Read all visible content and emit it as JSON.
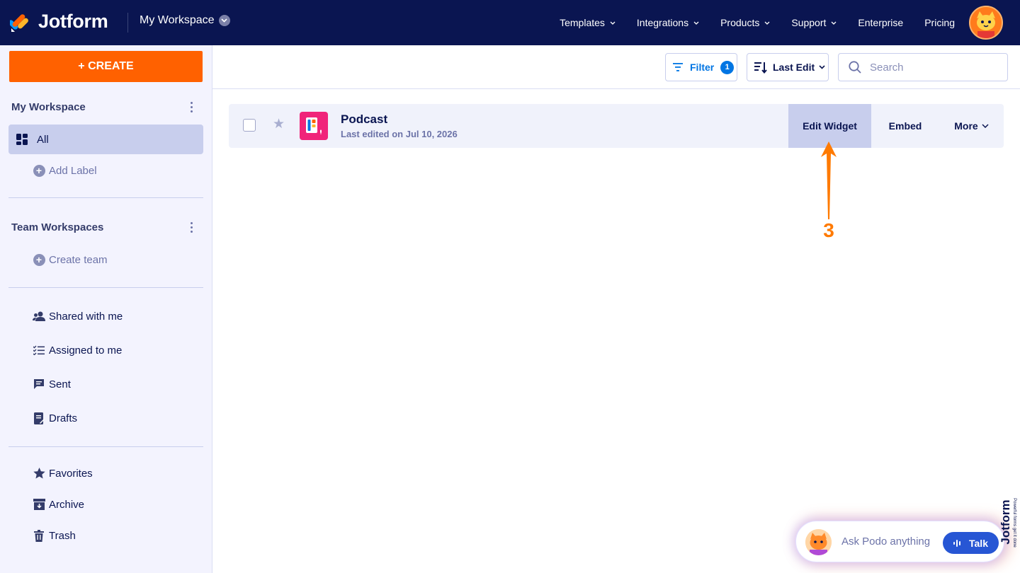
{
  "topbar": {
    "brand": "Jotform",
    "workspace": "My Workspace",
    "nav": [
      {
        "label": "Templates",
        "has_caret": true
      },
      {
        "label": "Integrations",
        "has_caret": true
      },
      {
        "label": "Products",
        "has_caret": true
      },
      {
        "label": "Support",
        "has_caret": true
      },
      {
        "label": "Enterprise",
        "has_caret": false
      },
      {
        "label": "Pricing",
        "has_caret": false
      }
    ]
  },
  "sidebar": {
    "create_label": "+ CREATE",
    "my_workspace": "My Workspace",
    "all_label": "All",
    "add_label": "Add Label",
    "team_workspaces": "Team Workspaces",
    "create_team": "Create team",
    "shared": "Shared with me",
    "assigned": "Assigned to me",
    "sent": "Sent",
    "drafts": "Drafts",
    "favorites": "Favorites",
    "archive": "Archive",
    "trash": "Trash"
  },
  "toolbar": {
    "filter_label": "Filter",
    "filter_count": "1",
    "sort_label": "Last Edit",
    "search_placeholder": "Search"
  },
  "form": {
    "title": "Podcast",
    "subtitle": "Last edited on Jul 10, 2026",
    "edit_label": "Edit Widget",
    "embed_label": "Embed",
    "more_label": "More"
  },
  "annotation": {
    "step": "3",
    "color": "#ff7a00"
  },
  "podo": {
    "prompt": "Ask Podo anything",
    "talk_label": "Talk",
    "brand": "Jotform",
    "tagline": "Powerful forms get it done"
  },
  "colors": {
    "nav_bg": "#0a1551",
    "create": "#ff6100",
    "accent": "#0075e3",
    "active_item": "#c8ceed",
    "sidebar_bg": "#f3f3fe"
  }
}
